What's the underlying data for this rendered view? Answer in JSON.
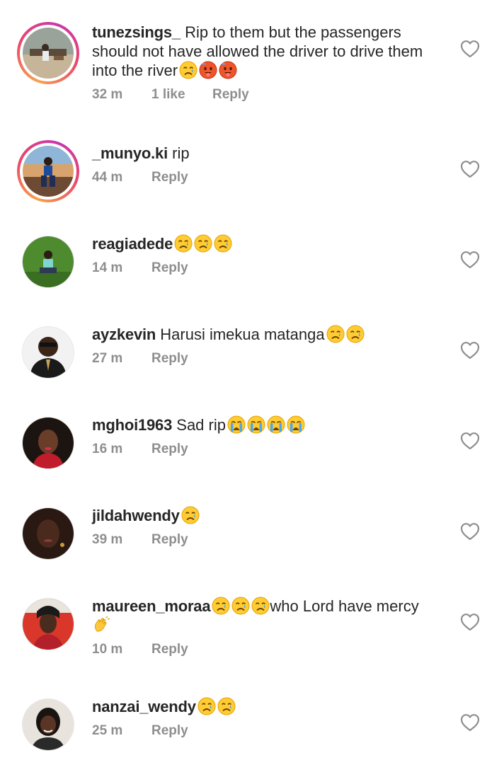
{
  "comments": [
    {
      "username": "tunezsings_",
      "text": "Rip to them but the passengers should not have allowed the driver to drive them into the river",
      "emojis": [
        "sad-tear-emoji",
        "hot-face-emoji",
        "hot-face-emoji"
      ],
      "time": "32 m",
      "likes": "1 like",
      "reply": "Reply"
    },
    {
      "username": "_munyo.ki",
      "text": "rip",
      "emojis": [],
      "time": "44 m",
      "reply": "Reply"
    },
    {
      "username": "reagiadede",
      "text": "",
      "emojis": [
        "sad-tear-emoji",
        "sad-tear-emoji",
        "sad-tear-emoji"
      ],
      "time": "14 m",
      "reply": "Reply"
    },
    {
      "username": "ayzkevin",
      "text": "Harusi imekua matanga",
      "emojis": [
        "sad-tear-emoji",
        "sad-tear-emoji"
      ],
      "time": "27 m",
      "reply": "Reply"
    },
    {
      "username": "mghoi1963",
      "text": "Sad rip",
      "emojis": [
        "crying-emoji",
        "crying-emoji",
        "crying-emoji",
        "crying-emoji"
      ],
      "time": "16 m",
      "reply": "Reply"
    },
    {
      "username": "jildahwendy",
      "text": "",
      "emojis": [
        "sad-tear-emoji"
      ],
      "time": "39 m",
      "reply": "Reply"
    },
    {
      "username": "maureen_moraa",
      "text": "who Lord have mercy",
      "emojis_before": [
        "sad-tear-emoji",
        "sad-tear-emoji",
        "sad-tear-emoji"
      ],
      "emojis_after": [
        "clapping-hands-emoji"
      ],
      "time": "10 m",
      "reply": "Reply"
    },
    {
      "username": "nanzai_wendy",
      "text": "",
      "emojis": [
        "sad-tear-emoji",
        "sad-tear-emoji"
      ],
      "time": "25 m",
      "reply": "Reply"
    }
  ],
  "icons": {
    "like": "heart-outline-icon"
  },
  "colors": {
    "username": "#262626",
    "meta": "#8e8e8e",
    "heart": "#8e8e8e"
  }
}
